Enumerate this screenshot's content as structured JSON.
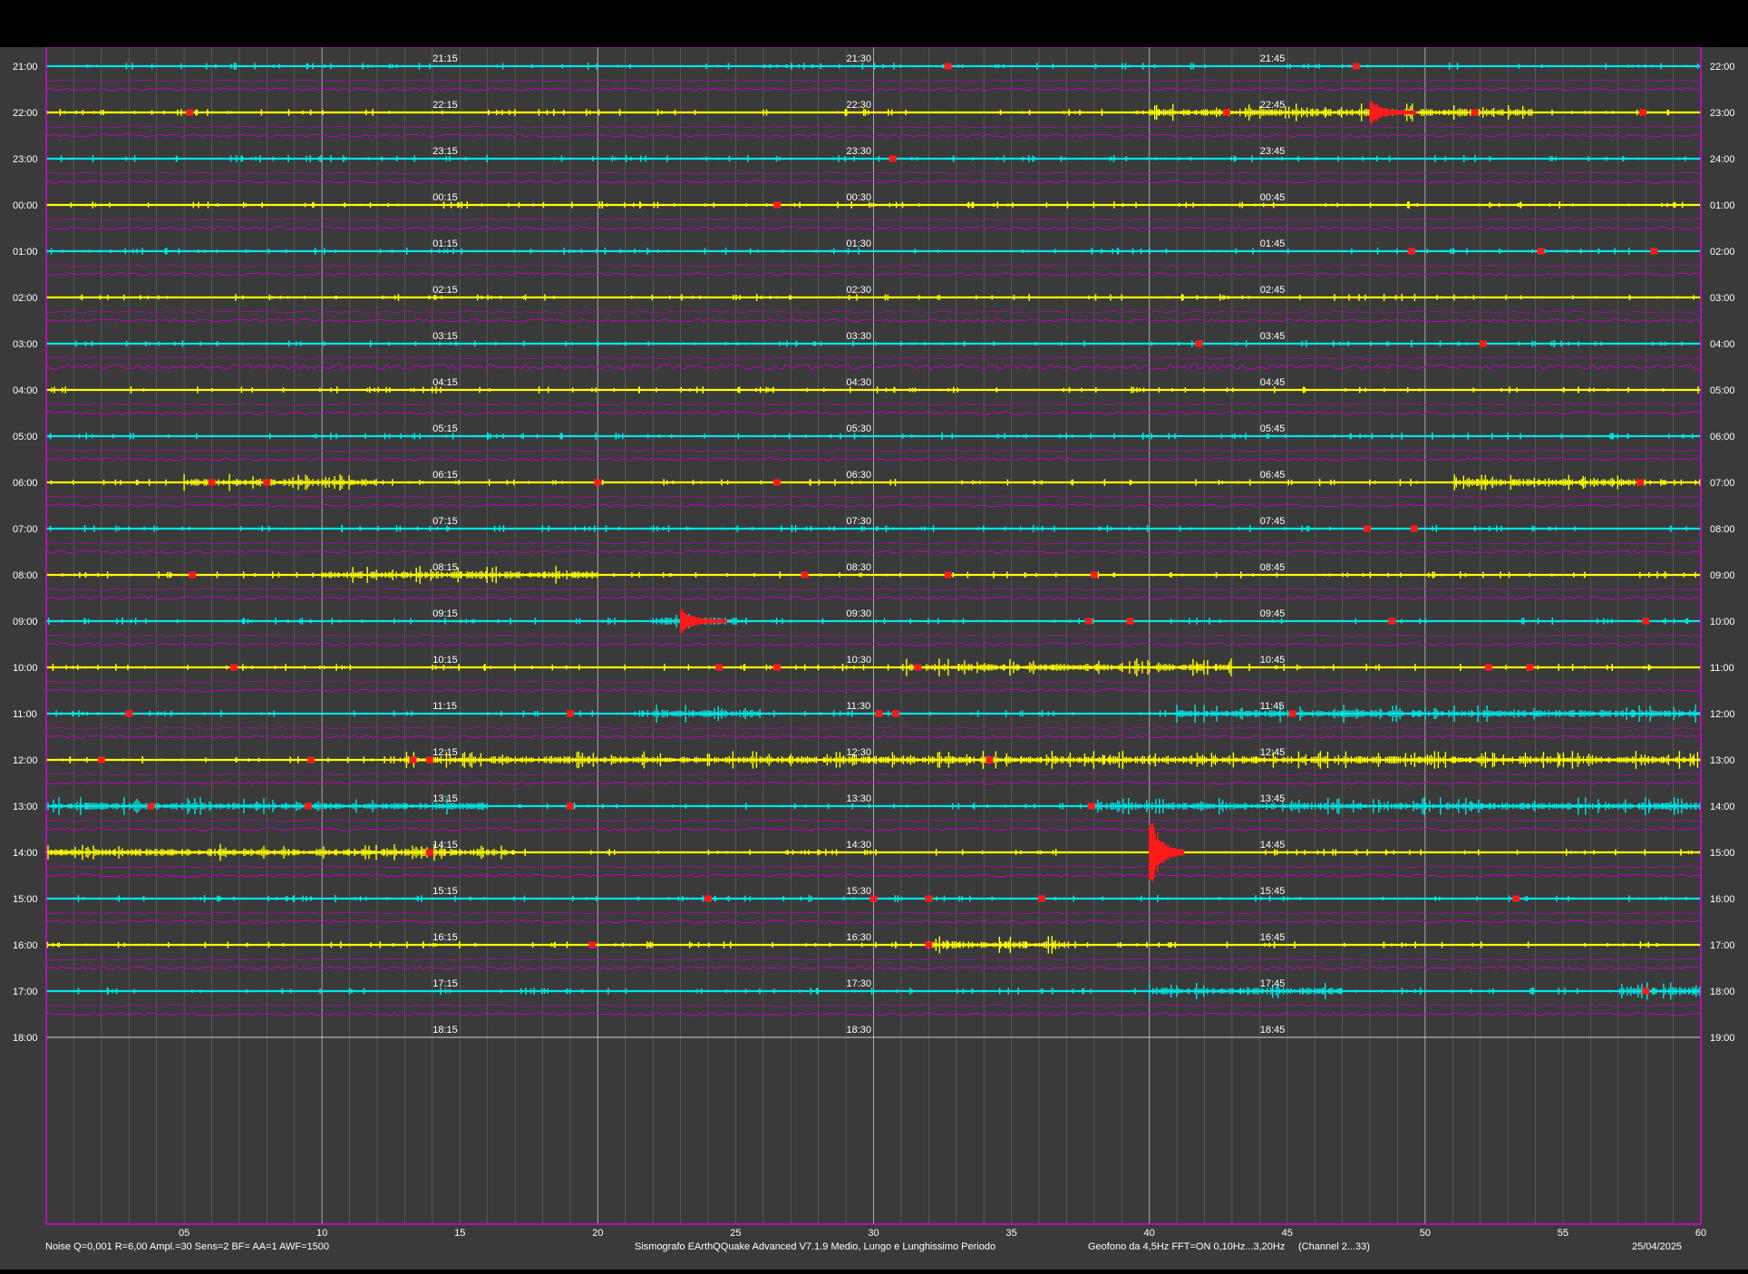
{
  "window": {
    "title_bar": ""
  },
  "colors": {
    "background": "#3a3a3a",
    "frame": "#e000e0",
    "noise_trace": "#c000c0",
    "trace_a": "#00e5e5",
    "trace_b": "#ffff00",
    "event": "#ff1a1a",
    "grid_major": "#a8a8a8",
    "grid_minor": "#6a6a6a",
    "label_text": "#ffffff"
  },
  "seismogram": {
    "left_hour_labels": [
      "21:00",
      "22:00",
      "23:00",
      "00:00",
      "01:00",
      "02:00",
      "03:00",
      "04:00",
      "05:00",
      "06:00",
      "07:00",
      "08:00",
      "09:00",
      "10:00",
      "11:00",
      "12:00",
      "13:00",
      "14:00",
      "15:00",
      "16:00",
      "17:00",
      "18:00"
    ],
    "right_hour_labels": [
      "22:00",
      "23:00",
      "24:00",
      "01:00",
      "02:00",
      "03:00",
      "04:00",
      "05:00",
      "06:00",
      "07:00",
      "08:00",
      "09:00",
      "10:00",
      "11:00",
      "12:00",
      "13:00",
      "14:00",
      "15:00",
      "16:00",
      "17:00",
      "18:00",
      "19:00"
    ],
    "quarter_labels": [
      [
        "21:15",
        "21:30",
        "21:45"
      ],
      [
        "22:15",
        "22:30",
        "22:45"
      ],
      [
        "23:15",
        "23:30",
        "23:45"
      ],
      [
        "00:15",
        "00:30",
        "00:45"
      ],
      [
        "01:15",
        "01:30",
        "01:45"
      ],
      [
        "02:15",
        "02:30",
        "02:45"
      ],
      [
        "03:15",
        "03:30",
        "03:45"
      ],
      [
        "04:15",
        "04:30",
        "04:45"
      ],
      [
        "05:15",
        "05:30",
        "05:45"
      ],
      [
        "06:15",
        "06:30",
        "06:45"
      ],
      [
        "07:15",
        "07:30",
        "07:45"
      ],
      [
        "08:15",
        "08:30",
        "08:45"
      ],
      [
        "09:15",
        "09:30",
        "09:45"
      ],
      [
        "10:15",
        "10:30",
        "10:45"
      ],
      [
        "11:15",
        "11:30",
        "11:45"
      ],
      [
        "12:15",
        "12:30",
        "12:45"
      ],
      [
        "13:15",
        "13:30",
        "13:45"
      ],
      [
        "14:15",
        "14:30",
        "14:45"
      ],
      [
        "15:15",
        "15:30",
        "15:45"
      ],
      [
        "16:15",
        "16:30",
        "16:45"
      ],
      [
        "17:15",
        "17:30",
        "17:45"
      ],
      [
        "18:15",
        "18:30",
        "18:45"
      ]
    ],
    "minute_ticks": [
      "05",
      "10",
      "15",
      "20",
      "25",
      "30",
      "35",
      "40",
      "45",
      "50",
      "55",
      "60"
    ],
    "active_rows": 21,
    "events": [
      {
        "row": 0,
        "minute": 32.7
      },
      {
        "row": 0,
        "minute": 47.5
      },
      {
        "row": 1,
        "minute": 5.2
      },
      {
        "row": 1,
        "minute": 42.8
      },
      {
        "row": 1,
        "minute": 48.0,
        "big": true
      },
      {
        "row": 1,
        "minute": 51.8
      },
      {
        "row": 1,
        "minute": 57.9
      },
      {
        "row": 2,
        "minute": 30.7
      },
      {
        "row": 3,
        "minute": 26.5
      },
      {
        "row": 4,
        "minute": 49.5
      },
      {
        "row": 4,
        "minute": 54.2
      },
      {
        "row": 4,
        "minute": 58.3
      },
      {
        "row": 6,
        "minute": 41.8
      },
      {
        "row": 6,
        "minute": 52.1
      },
      {
        "row": 9,
        "minute": 6.0
      },
      {
        "row": 9,
        "minute": 8.0
      },
      {
        "row": 9,
        "minute": 20.0
      },
      {
        "row": 9,
        "minute": 26.5
      },
      {
        "row": 9,
        "minute": 57.8
      },
      {
        "row": 10,
        "minute": 47.9
      },
      {
        "row": 10,
        "minute": 49.6
      },
      {
        "row": 11,
        "minute": 5.3
      },
      {
        "row": 11,
        "minute": 27.5
      },
      {
        "row": 11,
        "minute": 32.7
      },
      {
        "row": 11,
        "minute": 38.0
      },
      {
        "row": 12,
        "minute": 23.0,
        "big": true
      },
      {
        "row": 12,
        "minute": 37.8
      },
      {
        "row": 12,
        "minute": 39.3
      },
      {
        "row": 12,
        "minute": 48.8
      },
      {
        "row": 12,
        "minute": 58.0
      },
      {
        "row": 13,
        "minute": 6.8
      },
      {
        "row": 13,
        "minute": 24.4
      },
      {
        "row": 13,
        "minute": 26.5
      },
      {
        "row": 13,
        "minute": 31.6
      },
      {
        "row": 13,
        "minute": 52.3
      },
      {
        "row": 13,
        "minute": 53.8
      },
      {
        "row": 14,
        "minute": 3.0
      },
      {
        "row": 14,
        "minute": 19.0
      },
      {
        "row": 14,
        "minute": 30.2
      },
      {
        "row": 14,
        "minute": 30.8
      },
      {
        "row": 14,
        "minute": 45.2
      },
      {
        "row": 15,
        "minute": 2.0
      },
      {
        "row": 15,
        "minute": 9.6
      },
      {
        "row": 15,
        "minute": 13.3
      },
      {
        "row": 15,
        "minute": 13.9
      },
      {
        "row": 15,
        "minute": 34.2
      },
      {
        "row": 16,
        "minute": 3.8
      },
      {
        "row": 16,
        "minute": 9.5
      },
      {
        "row": 16,
        "minute": 19.0
      },
      {
        "row": 16,
        "minute": 37.9
      },
      {
        "row": 17,
        "minute": 13.9
      },
      {
        "row": 17,
        "minute": 40.0,
        "big": true
      },
      {
        "row": 18,
        "minute": 24.0
      },
      {
        "row": 18,
        "minute": 30.0
      },
      {
        "row": 18,
        "minute": 32.0
      },
      {
        "row": 18,
        "minute": 36.1
      },
      {
        "row": 18,
        "minute": 53.3
      },
      {
        "row": 19,
        "minute": 19.8
      },
      {
        "row": 19,
        "minute": 32.0
      },
      {
        "row": 20,
        "minute": 58.0
      }
    ],
    "bursts": [
      {
        "row": 1,
        "from": 40,
        "to": 54
      },
      {
        "row": 9,
        "from": 5,
        "to": 12
      },
      {
        "row": 9,
        "from": 51,
        "to": 58
      },
      {
        "row": 11,
        "from": 10,
        "to": 20
      },
      {
        "row": 12,
        "from": 22,
        "to": 25
      },
      {
        "row": 13,
        "from": 31,
        "to": 43
      },
      {
        "row": 14,
        "from": 22,
        "to": 26
      },
      {
        "row": 14,
        "from": 41,
        "to": 60
      },
      {
        "row": 15,
        "from": 13,
        "to": 60
      },
      {
        "row": 16,
        "from": 0,
        "to": 16
      },
      {
        "row": 16,
        "from": 38,
        "to": 60
      },
      {
        "row": 17,
        "from": 0,
        "to": 17
      },
      {
        "row": 19,
        "from": 32,
        "to": 37
      },
      {
        "row": 20,
        "from": 40,
        "to": 47
      },
      {
        "row": 20,
        "from": 57,
        "to": 60
      }
    ]
  },
  "footer": {
    "left": "Noise Q=0,001 R=6,00 Ampl.=30 Sens=2 BF= AA=1 AWF=1500",
    "center": "Sismografo  EArthQQuake Advanced V7.1.9  Medio, Lungo e Lunghissimo Periodo",
    "right_geofono": "Geofono da 4,5Hz FFT=ON 0,10Hz...3,20Hz",
    "right_channel": "(Channel 2...33)",
    "date": "25/04/2025"
  }
}
